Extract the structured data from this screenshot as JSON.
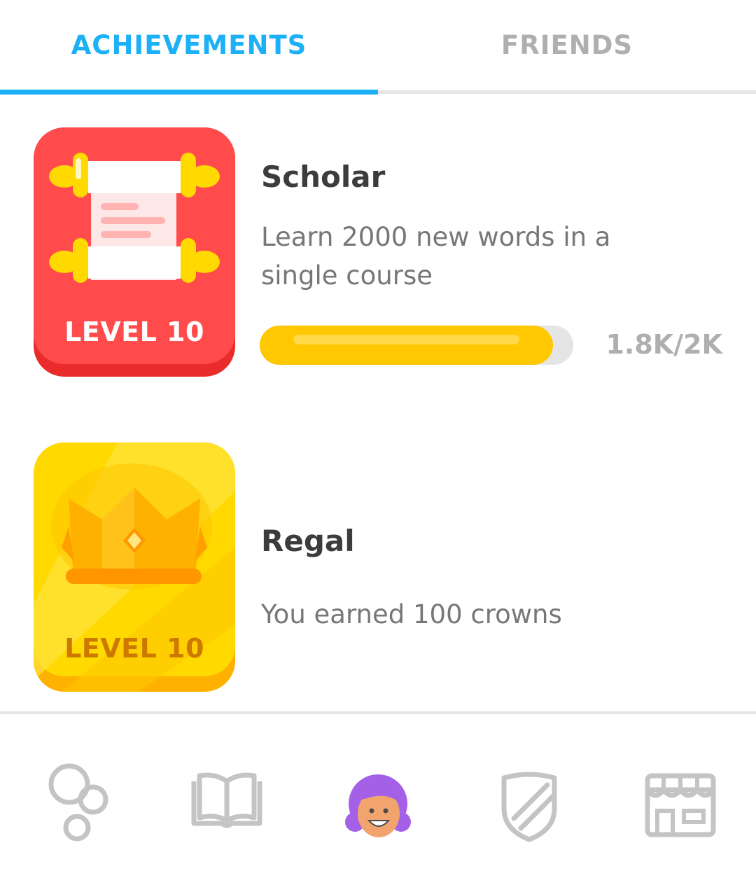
{
  "tabs": [
    {
      "label": "ACHIEVEMENTS",
      "active": true
    },
    {
      "label": "FRIENDS",
      "active": false
    }
  ],
  "achievements": [
    {
      "title": "Scholar",
      "description_line1": "Learn 2000 new words in a",
      "description_line2": "single course",
      "level": "LEVEL 10",
      "progress_text": "1.8K/2K",
      "progress_fraction": 0.9,
      "badge_color": "#ff4b4b",
      "icon": "scroll-icon"
    },
    {
      "title": "Regal",
      "description": "You earned 100 crowns",
      "level": "LEVEL 10",
      "badge_color": "#ffd900",
      "icon": "crown-icon"
    }
  ],
  "bottom_nav": [
    {
      "icon": "learn-circles-icon",
      "active": false
    },
    {
      "icon": "stories-book-icon",
      "active": false
    },
    {
      "icon": "profile-avatar-icon",
      "active": true
    },
    {
      "icon": "leagues-shield-icon",
      "active": false
    },
    {
      "icon": "shop-store-icon",
      "active": false
    }
  ],
  "colors": {
    "accent": "#1cb0f6",
    "inactive": "#afafaf",
    "progress": "#ffc800"
  }
}
